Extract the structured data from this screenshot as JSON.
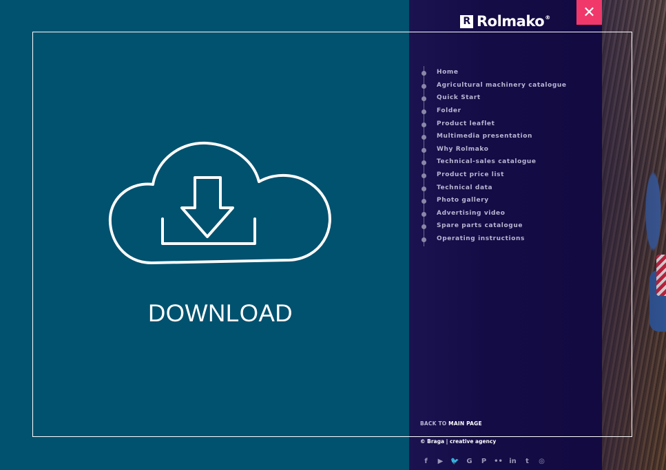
{
  "brand": {
    "name": "Rolmako",
    "mark": "R",
    "registered": "®"
  },
  "download": {
    "label": "DOWNLOAD"
  },
  "menu": {
    "close_label": "✕",
    "items": [
      {
        "label": "Home"
      },
      {
        "label": "Agricultural machinery catalogue"
      },
      {
        "label": "Quick Start"
      },
      {
        "label": "Folder"
      },
      {
        "label": "Product leaflet"
      },
      {
        "label": "Multimedia presentation"
      },
      {
        "label": "Why Rolmako"
      },
      {
        "label": "Technical-sales catalogue"
      },
      {
        "label": "Product price list"
      },
      {
        "label": "Technical data"
      },
      {
        "label": "Photo gallery"
      },
      {
        "label": "Advertising video"
      },
      {
        "label": "Spare parts catalogue"
      },
      {
        "label": "Operating instructions"
      }
    ],
    "back_prefix": "BACK TO ",
    "back_strong": "MAIN PAGE",
    "credits": "© Braga | creative agency"
  },
  "socials": [
    {
      "icon": "facebook-icon",
      "glyph": "f"
    },
    {
      "icon": "youtube-icon",
      "glyph": "▶"
    },
    {
      "icon": "twitter-icon",
      "glyph": "🐦"
    },
    {
      "icon": "google-plus-icon",
      "glyph": "G"
    },
    {
      "icon": "pinterest-icon",
      "glyph": "P"
    },
    {
      "icon": "flickr-icon",
      "glyph": "••"
    },
    {
      "icon": "linkedin-icon",
      "glyph": "in"
    },
    {
      "icon": "tumblr-icon",
      "glyph": "t"
    },
    {
      "icon": "instagram-icon",
      "glyph": "◎"
    }
  ],
  "colors": {
    "left_panel": "#01526f",
    "menu_panel": "#140c45",
    "close_button": "#f0386b",
    "menu_text": "#b9b6d4"
  }
}
